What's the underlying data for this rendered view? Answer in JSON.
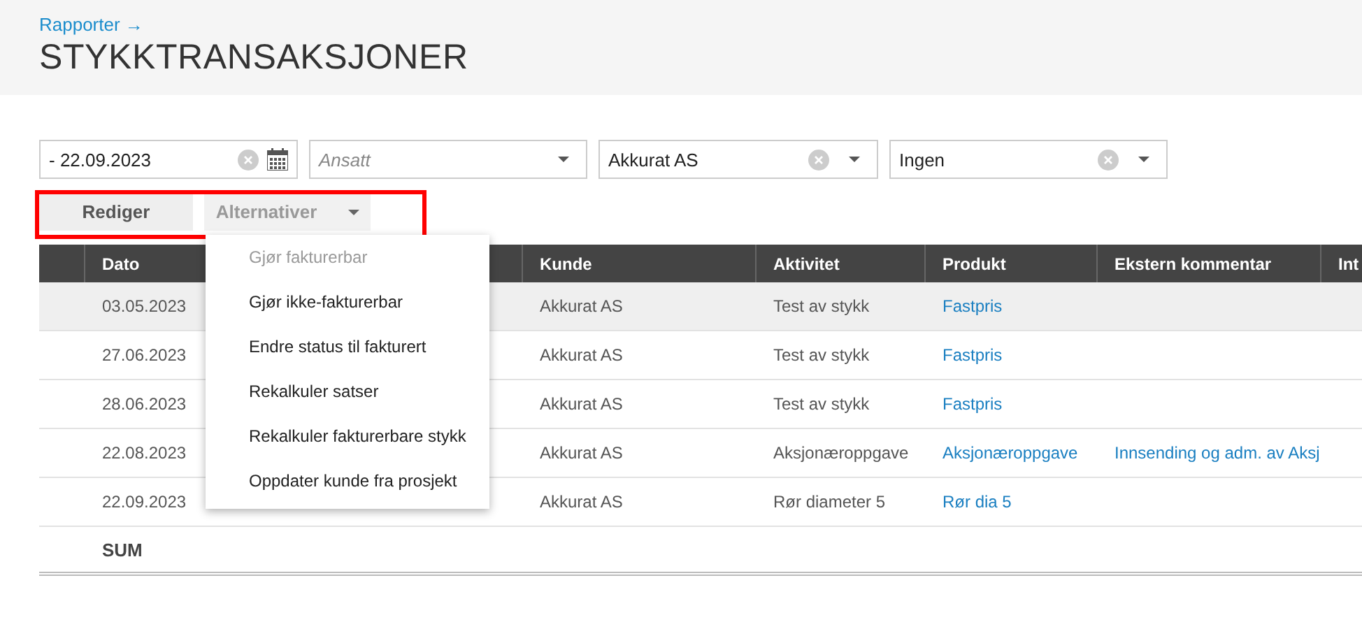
{
  "breadcrumb": "Rapporter →",
  "title": "STYKKTRANSAKSJONER",
  "filters": [
    {
      "kind": "date",
      "value": "- 22.09.2023",
      "clearable": true
    },
    {
      "kind": "select",
      "placeholder": "Ansatt",
      "clearable": false
    },
    {
      "kind": "select",
      "value": "Akkurat AS",
      "clearable": true
    },
    {
      "kind": "select",
      "value": "Ingen",
      "clearable": true
    }
  ],
  "toolbar": {
    "edit_button": "Rediger",
    "options_button": "Alternativer",
    "highlighted": true
  },
  "options_menu": [
    {
      "label": "Gjør fakturerbar",
      "disabled": true
    },
    {
      "label": "Gjør ikke-fakturerbar",
      "disabled": false
    },
    {
      "label": "Endre status til fakturert",
      "disabled": false
    },
    {
      "label": "Rekalkuler satser",
      "disabled": false
    },
    {
      "label": "Rekalkuler fakturerbare stykk",
      "disabled": false
    },
    {
      "label": "Oppdater kunde fra prosjekt",
      "disabled": false
    }
  ],
  "table": {
    "columns": [
      "Dato",
      "Kunde",
      "Aktivitet",
      "Produkt",
      "Ekstern kommentar",
      "Int"
    ],
    "rows": [
      {
        "selected": true,
        "dato": "03.05.2023",
        "kunde": "Akkurat AS",
        "aktivitet": "Test av stykk",
        "produkt": "Fastpris"
      },
      {
        "selected": false,
        "dato": "27.06.2023",
        "kunde": "Akkurat AS",
        "aktivitet": "Test av stykk",
        "produkt": "Fastpris"
      },
      {
        "selected": false,
        "dato": "28.06.2023",
        "kunde": "Akkurat AS",
        "aktivitet": "Test av stykk",
        "produkt": "Fastpris"
      },
      {
        "selected": false,
        "dato": "22.08.2023",
        "kunde": "Akkurat AS",
        "aktivitet": "Aksjonæroppgave",
        "produkt": "Aksjonæroppgave",
        "kommentar": "Innsending og adm. av Aksj"
      },
      {
        "selected": false,
        "dato": "22.09.2023",
        "kunde": "Akkurat AS",
        "aktivitet": "Rør diameter 5",
        "produkt": "Rør dia 5"
      }
    ],
    "sum_label": "SUM"
  }
}
